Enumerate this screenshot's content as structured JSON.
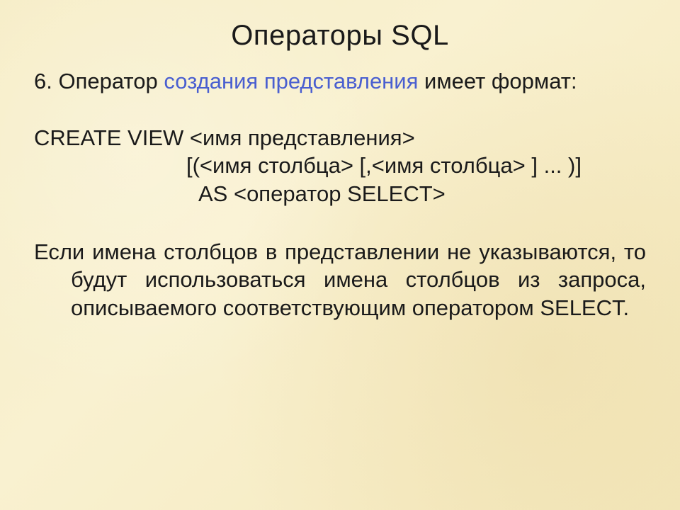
{
  "title": "Операторы SQL",
  "intro": {
    "num": "6.",
    "before": "Оператор",
    "linked": "создания представления",
    "after": "имеет формат:"
  },
  "syntax": {
    "line1": "CREATE VIEW <имя представления>",
    "line2": "[(<имя столбца> [,<имя столбца> ] ... )]",
    "line3": "AS <оператор SELECT>"
  },
  "note": "Если имена столбцов в представлении не указываются, то будут использоваться имена столбцов из запроса, описываемого соответствующим оператором SELECT."
}
